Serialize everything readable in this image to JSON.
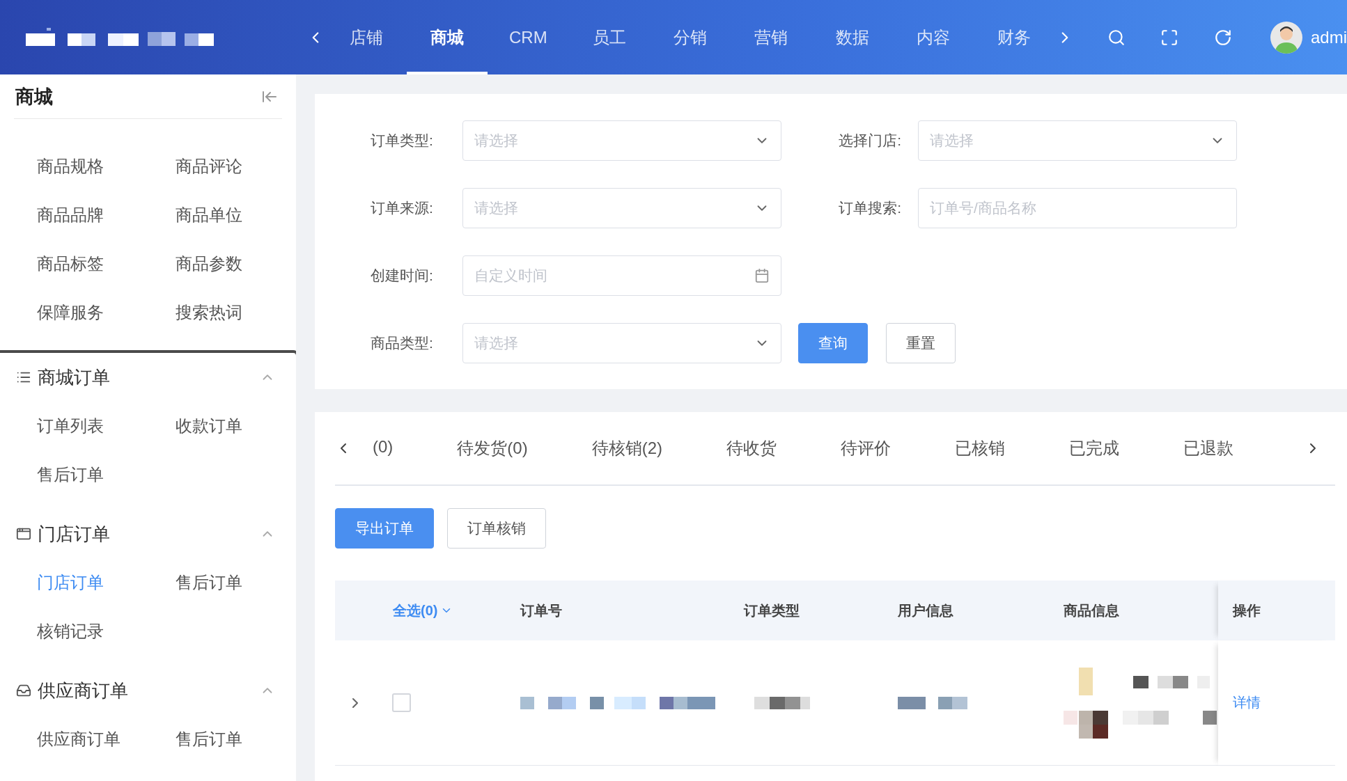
{
  "header": {
    "nav": [
      {
        "label": "店铺",
        "selected": false
      },
      {
        "label": "商城",
        "selected": true
      },
      {
        "label": "CRM",
        "selected": false
      },
      {
        "label": "员工",
        "selected": false
      },
      {
        "label": "分销",
        "selected": false
      },
      {
        "label": "营销",
        "selected": false
      },
      {
        "label": "数据",
        "selected": false
      },
      {
        "label": "内容",
        "selected": false
      },
      {
        "label": "财务",
        "selected": false
      }
    ],
    "user": {
      "name": "admi"
    }
  },
  "sidebar": {
    "title": "商城",
    "top_items": [
      {
        "label": "商品规格",
        "selected": false
      },
      {
        "label": "商品评论",
        "selected": false
      },
      {
        "label": "商品品牌",
        "selected": false
      },
      {
        "label": "商品单位",
        "selected": false
      },
      {
        "label": "商品标签",
        "selected": false
      },
      {
        "label": "商品参数",
        "selected": false
      },
      {
        "label": "保障服务",
        "selected": false
      },
      {
        "label": "搜索热词",
        "selected": false
      }
    ],
    "sections": [
      {
        "title": "商城订单",
        "kind": "list",
        "expanded": true,
        "items": [
          {
            "label": "订单列表",
            "selected": false
          },
          {
            "label": "收款订单",
            "selected": false
          },
          {
            "label": "售后订单",
            "selected": false
          }
        ]
      },
      {
        "title": "门店订单",
        "kind": "window",
        "expanded": true,
        "items": [
          {
            "label": "门店订单",
            "selected": true
          },
          {
            "label": "售后订单",
            "selected": false
          },
          {
            "label": "核销记录",
            "selected": false
          }
        ]
      },
      {
        "title": "供应商订单",
        "kind": "inbox",
        "expanded": true,
        "items": [
          {
            "label": "供应商订单",
            "selected": false
          },
          {
            "label": "售后订单",
            "selected": false
          }
        ]
      }
    ]
  },
  "filters": {
    "fields": [
      {
        "label": "订单类型:",
        "kind": "select",
        "placeholder": "请选择"
      },
      {
        "label": "选择门店:",
        "kind": "select",
        "placeholder": "请选择"
      },
      {
        "label": "订单来源:",
        "kind": "select",
        "placeholder": "请选择"
      },
      {
        "label": "订单搜索:",
        "kind": "input",
        "placeholder": "订单号/商品名称"
      },
      {
        "label": "创建时间:",
        "kind": "date",
        "placeholder": "自定义时间"
      },
      {
        "label": "商品类型:",
        "kind": "select",
        "placeholder": "请选择"
      }
    ],
    "buttons": [
      {
        "label": "查询",
        "kind": "primary"
      },
      {
        "label": "重置",
        "kind": "default"
      }
    ]
  },
  "tabs": [
    {
      "label": "(0)",
      "selected": false
    },
    {
      "label": "待发货(0)",
      "selected": false
    },
    {
      "label": "待核销(2)",
      "selected": false
    },
    {
      "label": "待收货",
      "selected": false
    },
    {
      "label": "待评价",
      "selected": false
    },
    {
      "label": "已核销",
      "selected": false
    },
    {
      "label": "已完成",
      "selected": false
    },
    {
      "label": "已退款",
      "selected": false
    }
  ],
  "actions": [
    {
      "label": "导出订单",
      "kind": "primary"
    },
    {
      "label": "订单核销",
      "kind": "default"
    }
  ],
  "table": {
    "select_all": "全选(0)",
    "columns": [
      "订单号",
      "订单类型",
      "用户信息",
      "商品信息",
      "操作"
    ],
    "rows": [
      {
        "expanded": false,
        "checked": false,
        "action": "详情"
      }
    ]
  }
}
